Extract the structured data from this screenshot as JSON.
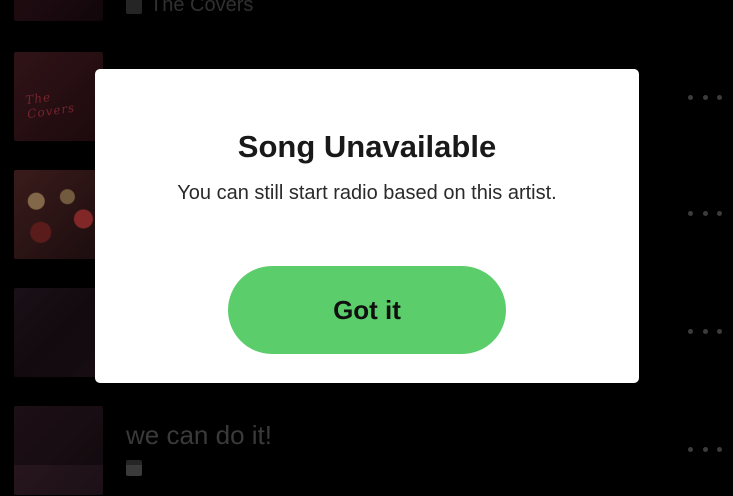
{
  "track_list": {
    "top_subtitle": "The Covers",
    "bottom_title": "we can do it!",
    "more_icon": "more-options-icon"
  },
  "dialog": {
    "title": "Song Unavailable",
    "message": "You can still start radio based on this artist.",
    "confirm_label": "Got it"
  },
  "colors": {
    "accent_green": "#5ccd6b",
    "dialog_bg": "#ffffff",
    "app_bg": "#000000"
  }
}
